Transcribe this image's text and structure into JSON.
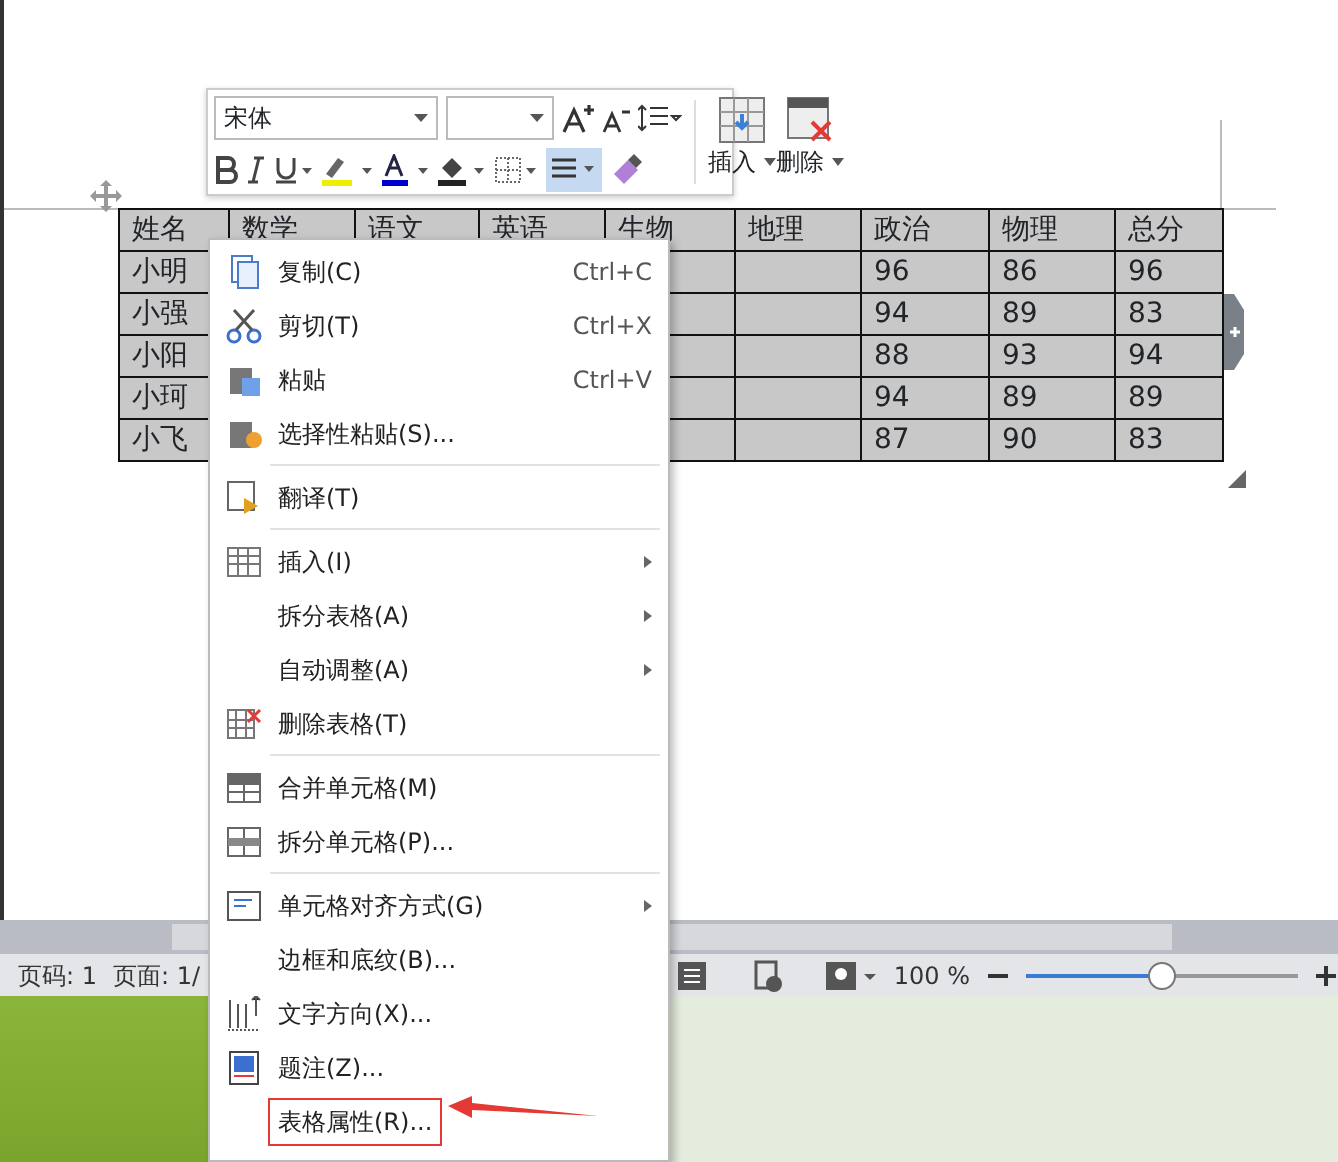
{
  "toolbar": {
    "font": "宋体",
    "insert": "插入",
    "delete": "删除",
    "align_selected": true
  },
  "table": {
    "columns": [
      "姓名",
      "数学",
      "语文",
      "英语",
      "生物",
      "地理",
      "政治",
      "物理",
      "总分"
    ],
    "rows": [
      {
        "name": "小明",
        "column_6": "96",
        "column_7": "86",
        "column_8": "96"
      },
      {
        "name": "小强",
        "column_6": "94",
        "column_7": "89",
        "column_8": "83"
      },
      {
        "name": "小阳",
        "column_6": "88",
        "column_7": "93",
        "column_8": "94"
      },
      {
        "name": "小珂",
        "column_6": "94",
        "column_7": "89",
        "column_8": "89"
      },
      {
        "name": "小飞",
        "column_6": "87",
        "column_7": "90",
        "column_8": "83"
      }
    ]
  },
  "context_menu": [
    {
      "kind": "item",
      "label": "复制(C)",
      "shortcut": "Ctrl+C"
    },
    {
      "kind": "item",
      "label": "剪切(T)",
      "shortcut": "Ctrl+X"
    },
    {
      "kind": "item",
      "label": "粘贴",
      "shortcut": "Ctrl+V"
    },
    {
      "kind": "item",
      "label": "选择性粘贴(S)..."
    },
    {
      "kind": "separator"
    },
    {
      "kind": "item",
      "label": "翻译(T)"
    },
    {
      "kind": "separator"
    },
    {
      "kind": "submenu",
      "label": "插入(I)"
    },
    {
      "kind": "submenu",
      "label": "拆分表格(A)"
    },
    {
      "kind": "submenu",
      "label": "自动调整(A)"
    },
    {
      "kind": "item",
      "label": "删除表格(T)"
    },
    {
      "kind": "separator"
    },
    {
      "kind": "item",
      "label": "合并单元格(M)"
    },
    {
      "kind": "item",
      "label": "拆分单元格(P)..."
    },
    {
      "kind": "separator"
    },
    {
      "kind": "submenu",
      "label": "单元格对齐方式(G)"
    },
    {
      "kind": "item",
      "label": "边框和底纹(B)..."
    },
    {
      "kind": "item",
      "label": "文字方向(X)..."
    },
    {
      "kind": "item",
      "label": "题注(Z)..."
    },
    {
      "kind": "item",
      "label": "表格属性(R)...",
      "highlighted": true
    }
  ],
  "status_bar": {
    "page_number": "页码: 1",
    "pages": "页面: 1/",
    "zoom": "100 %",
    "zoom_slider": {
      "level": 0.5
    }
  }
}
